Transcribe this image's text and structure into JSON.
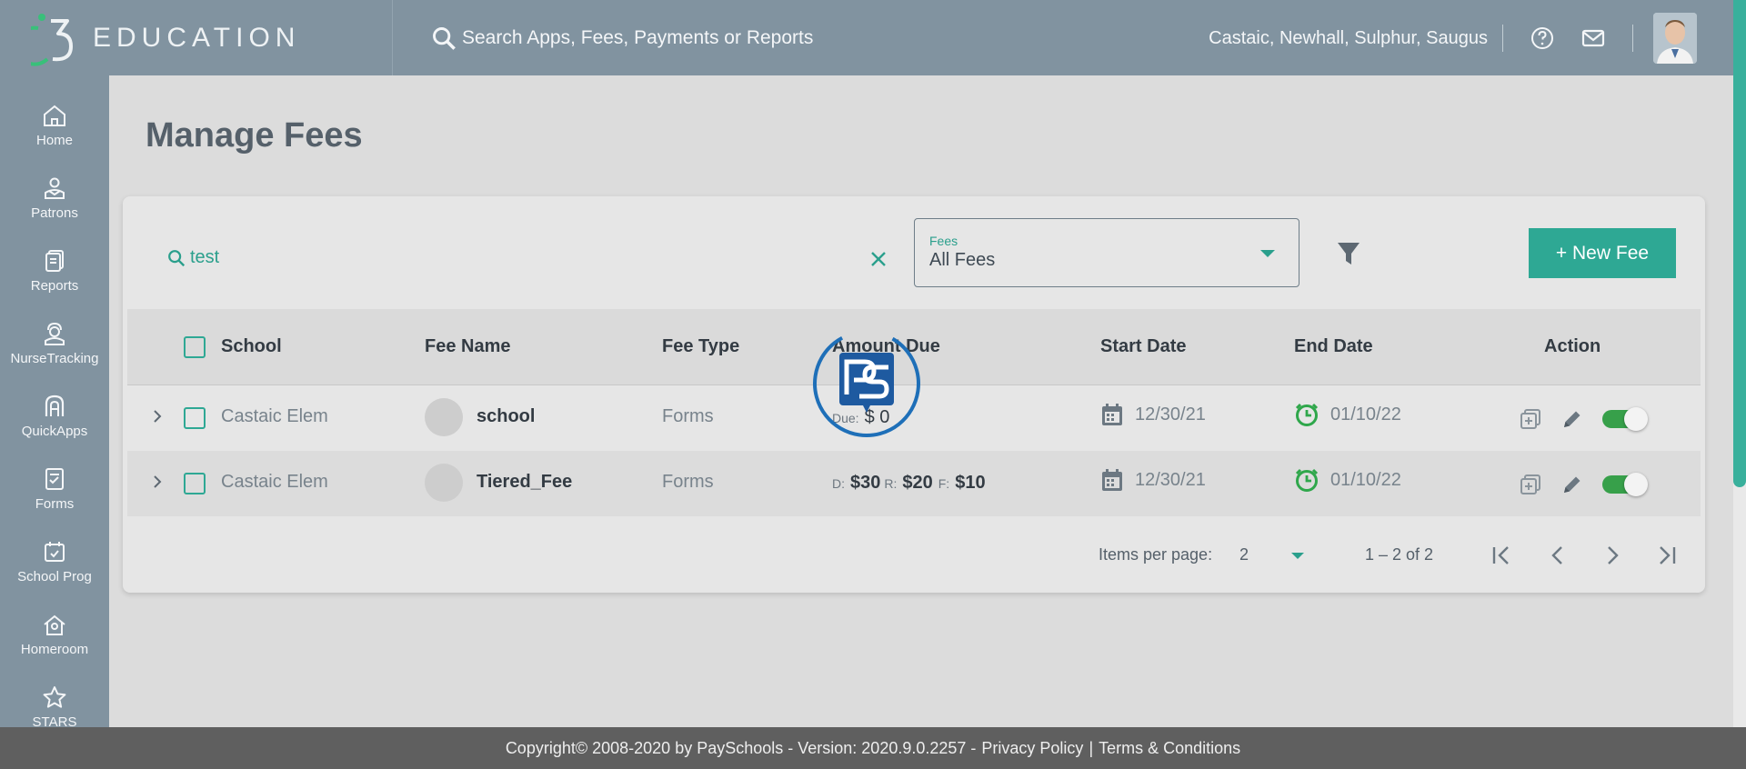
{
  "app": {
    "logo_text": "EDUCATION",
    "search_placeholder": "Search Apps, Fees, Payments or Reports",
    "district": "Castaic, Newhall, Sulphur, Saugus"
  },
  "sidebar": {
    "items": [
      {
        "label": "Home",
        "icon": "home-icon"
      },
      {
        "label": "Patrons",
        "icon": "patrons-icon"
      },
      {
        "label": "Reports",
        "icon": "reports-icon"
      },
      {
        "label": "NurseTracking",
        "icon": "nurse-icon"
      },
      {
        "label": "QuickApps",
        "icon": "quickapps-icon"
      },
      {
        "label": "Forms",
        "icon": "forms-icon"
      },
      {
        "label": "School Prog",
        "icon": "calendar-icon"
      },
      {
        "label": "Homeroom",
        "icon": "homeroom-icon"
      },
      {
        "label": "STARS",
        "icon": "star-icon"
      }
    ]
  },
  "page": {
    "title": "Manage Fees"
  },
  "filters": {
    "search_value": "test",
    "fees_select_label": "Fees",
    "fees_select_value": "All Fees",
    "new_fee_label": "+ New Fee"
  },
  "table": {
    "headers": {
      "school": "School",
      "fee_name": "Fee Name",
      "fee_type": "Fee Type",
      "amount_due": "Amount Due",
      "start_date": "Start Date",
      "end_date": "End Date",
      "action": "Action"
    },
    "rows": [
      {
        "school": "Castaic Elem",
        "fee_name": "school",
        "fee_type": "Forms",
        "amount_label_1": "Due:",
        "amount_value_1": "$ 0",
        "start_date": "12/30/21",
        "end_date": "01/10/22",
        "active": true
      },
      {
        "school": "Castaic Elem",
        "fee_name": "Tiered_Fee",
        "fee_type": "Forms",
        "amount_label_1": "D:",
        "amount_value_1": "$30",
        "amount_label_2": "R:",
        "amount_value_2": "$20",
        "amount_label_3": "F:",
        "amount_value_3": "$10",
        "start_date": "12/30/21",
        "end_date": "01/10/22",
        "active": true
      }
    ]
  },
  "paginator": {
    "items_per_page_label": "Items per page:",
    "items_per_page_value": "2",
    "range": "1 – 2 of 2"
  },
  "footer": {
    "copyright": "Copyright© 2008-2020 by PaySchools - Version: 2020.9.0.2257 -",
    "privacy": "Privacy Policy",
    "divider": "|",
    "terms": "Terms & Conditions"
  },
  "colors": {
    "header_bg": "#8193a0",
    "accent": "#2ea894",
    "toggle_on": "#37a04a",
    "footer_bg": "#5f5f5f"
  }
}
